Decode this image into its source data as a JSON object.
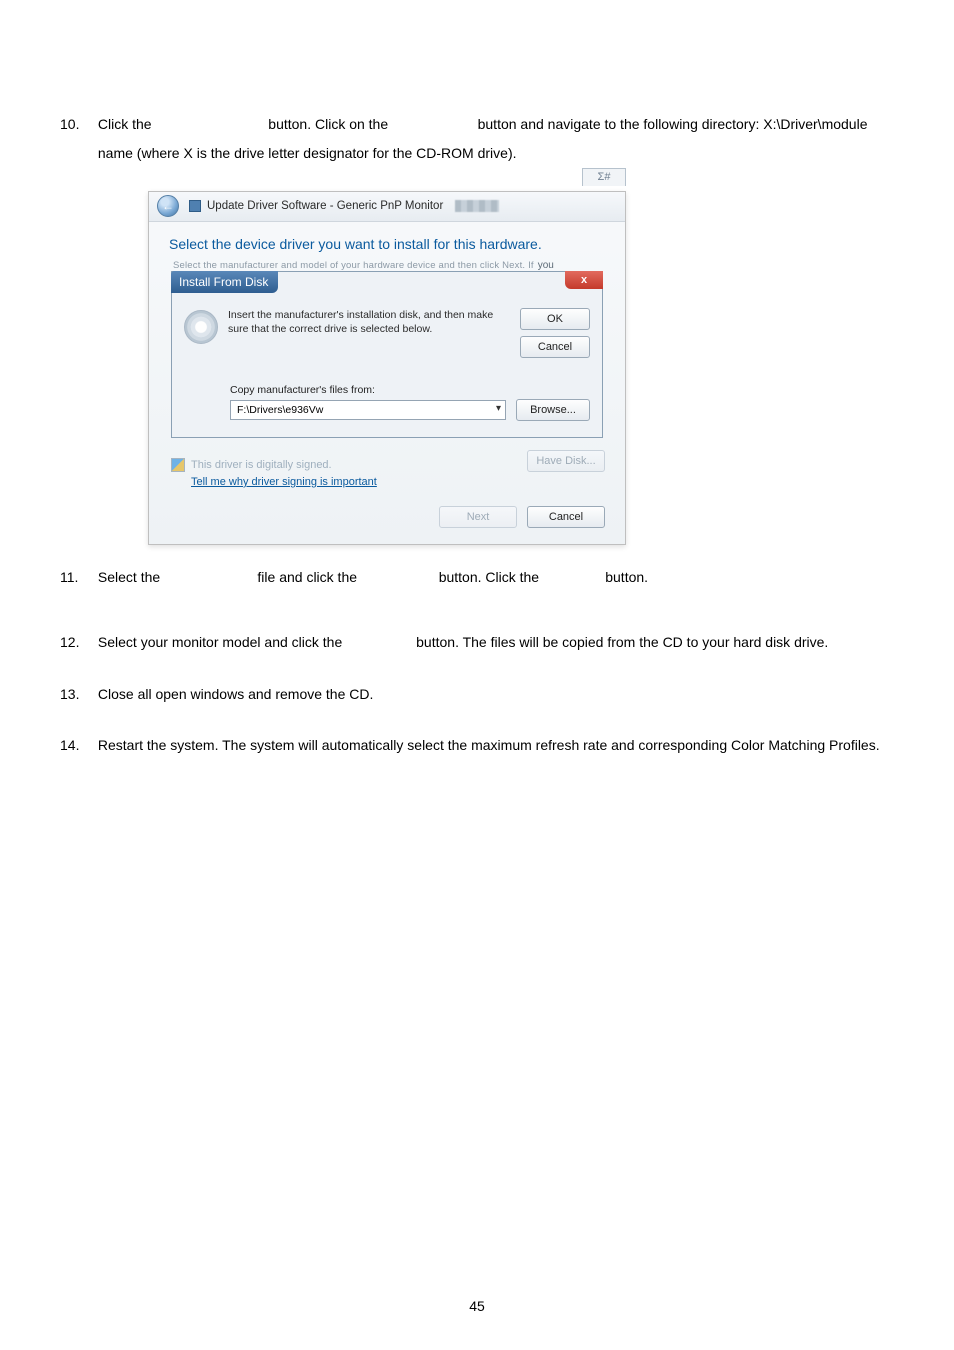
{
  "items": [
    {
      "num": "10.",
      "text_a": "Click the ",
      "text_b": " button. Click on the ",
      "text_c": " button and navigate to the following directory: X:\\Driver\\module name (where X is the drive letter designator for the CD-ROM drive)."
    },
    {
      "num": "11.",
      "text_a": "Select the ",
      "text_b": " file and click the ",
      "text_c": " button. Click the ",
      "text_d": " button."
    },
    {
      "num": "12.",
      "text_a": "Select your monitor model and click the ",
      "text_b": " button. The files will be copied from the CD to your hard disk drive."
    },
    {
      "num": "13.",
      "text_a": "Close all open windows and remove the CD."
    },
    {
      "num": "14.",
      "text_a": "Restart the system. The system will automatically select the maximum refresh rate and corresponding Color Matching Profiles."
    }
  ],
  "win": {
    "close_glyph": "Σ#",
    "crumb": "Update Driver Software - Generic PnP Monitor",
    "heading": "Select the device driver you want to install for this hardware.",
    "ghost_text": "Select the manufacturer and model of your hardware device and then click Next. If",
    "ghost_tail": "you"
  },
  "ifd": {
    "title": "Install From Disk",
    "close": "x",
    "msg1": "Insert the manufacturer's installation disk, and then make",
    "msg2": "sure that the correct drive is selected below.",
    "ok": "OK",
    "cancel": "Cancel",
    "copy_label": "Copy manufacturer's files from:",
    "path": "F:\\Drivers\\e936Vw",
    "browse": "Browse..."
  },
  "bottom": {
    "signed": "This driver is digitally signed.",
    "link": "Tell me why driver signing is important",
    "have_disk": "Have Disk...",
    "next": "Next",
    "cancel": "Cancel"
  },
  "page_number": "45"
}
